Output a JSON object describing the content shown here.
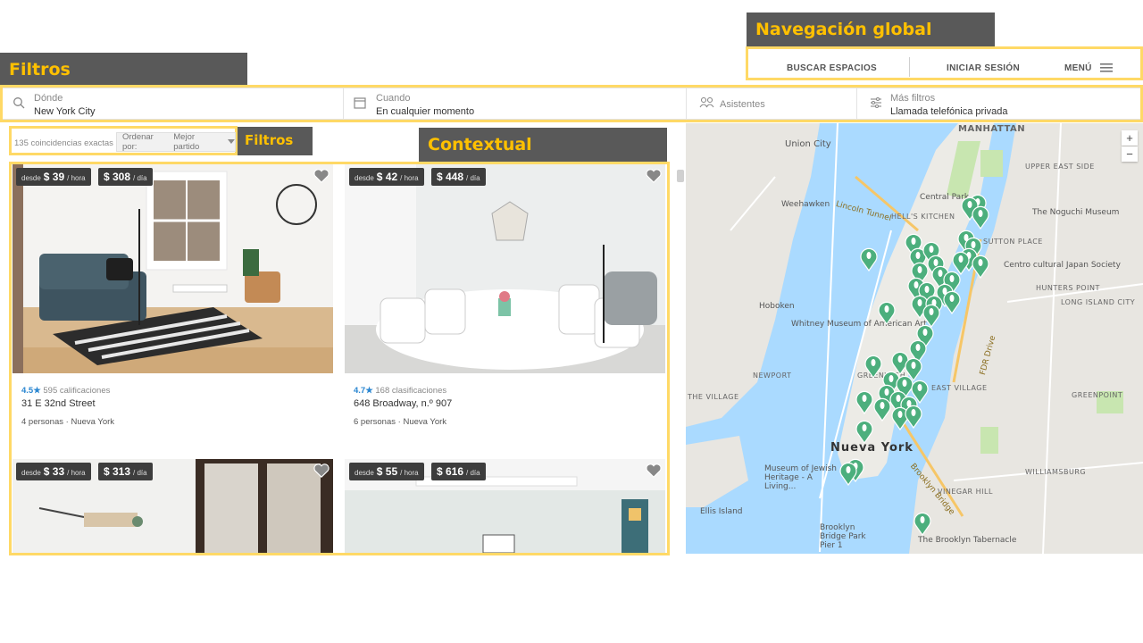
{
  "annotations": {
    "global_nav": "Navegación global",
    "filters_top": "Filtros",
    "filters_sort": "Filtros",
    "contextual": "Contextual"
  },
  "nav": {
    "search_spaces": "BUSCAR ESPACIOS",
    "login": "INICIAR SESIÓN",
    "menu": "MENÚ"
  },
  "filters": {
    "where_label": "Dónde",
    "where_value": "New York City",
    "when_label": "Cuando",
    "when_value": "En cualquier momento",
    "attendees_label": "Asistentes",
    "more_label": "Más filtros",
    "more_value": "Llamada telefónica privada"
  },
  "results": {
    "count": "135 coincidencias exactas",
    "sort_label": "Ordenar por:",
    "sort_value": "Mejor partido"
  },
  "cards": [
    {
      "from": "desde",
      "hour_price": "$ 39",
      "hour_unit": "/ hora",
      "day_price": "$ 308",
      "day_unit": "/ día",
      "score": "4.5★",
      "reviews": "595 calificaciones",
      "address": "31 E 32nd Street",
      "people": "4 personas",
      "city": "Nueva York"
    },
    {
      "from": "desde",
      "hour_price": "$ 42",
      "hour_unit": "/ hora",
      "day_price": "$ 448",
      "day_unit": "/ día",
      "score": "4.7★",
      "reviews": "168 clasificaciones",
      "address": "648 Broadway, n.º 907",
      "people": "6 personas",
      "city": "Nueva York"
    },
    {
      "from": "desde",
      "hour_price": "$ 33",
      "hour_unit": "/ hora",
      "day_price": "$ 313",
      "day_unit": "/ día"
    },
    {
      "from": "desde",
      "hour_price": "$ 55",
      "hour_unit": "/ hora",
      "day_price": "$ 616",
      "day_unit": "/ día"
    }
  ],
  "map": {
    "labels": {
      "manhattan": "MANHATTAN",
      "union_city": "Union City",
      "weehawken": "Weehawken",
      "lincoln_tunnel": "Lincoln Tunnel",
      "hells_kitchen": "HELL'S KITCHEN",
      "central_park": "Central Park",
      "upper_east_side": "UPPER EAST SIDE",
      "noguchi": "The Noguchi Museum",
      "sutton_place": "SUTTON PLACE",
      "japan_society": "Centro cultural Japan Society",
      "hunters_point": "HUNTERS POINT",
      "long_island_city": "LONG ISLAND CITY",
      "hoboken": "Hoboken",
      "whitney": "Whitney Museum of American Art",
      "greenwich": "GREENWICH",
      "newport": "NEWPORT",
      "east_village": "EAST VILLAGE",
      "the_village": "THE VILLAGE",
      "greenpoint": "GREENPOINT",
      "nueva_york": "Nueva York",
      "jewish_heritage": "Museum of Jewish Heritage - A Living...",
      "williamsburg": "WILLIAMSBURG",
      "vinegar_hill": "VINEGAR HILL",
      "ellis_island": "Ellis Island",
      "brooklyn_bridge_park": "Brooklyn Bridge Park Pier 1",
      "brooklyn_tabernacle": "The Brooklyn Tabernacle",
      "fdr_drive": "FDR Drive",
      "brooklyn_bridge": "Brooklyn Bridge"
    },
    "zoom_in": "+",
    "zoom_out": "−",
    "marker_color": "#4caf7d"
  }
}
